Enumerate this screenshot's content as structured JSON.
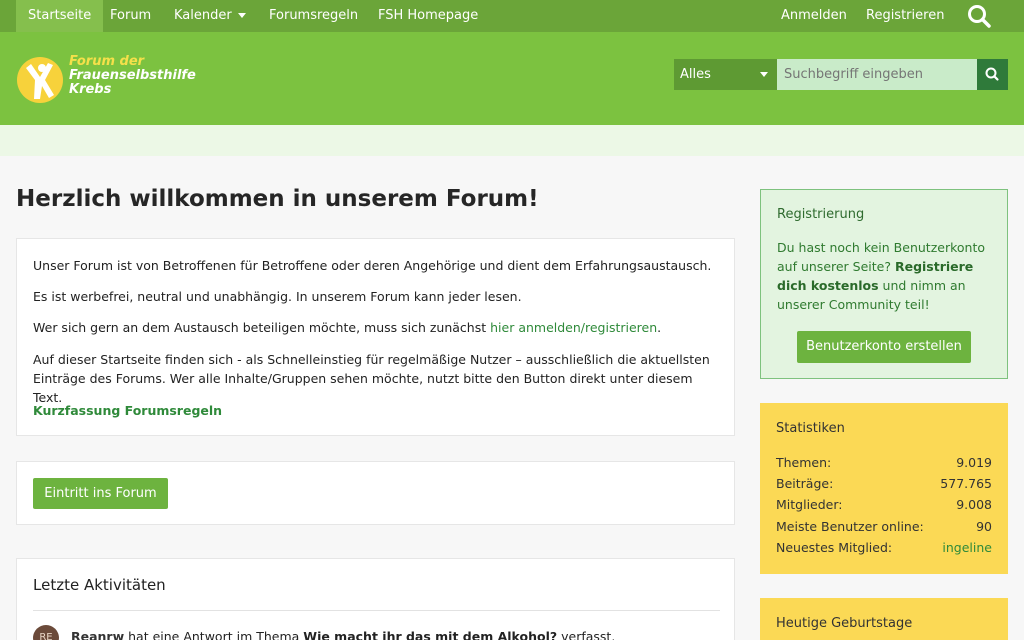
{
  "nav": {
    "items": [
      {
        "label": "Startseite"
      },
      {
        "label": "Forum"
      },
      {
        "label": "Kalender"
      },
      {
        "label": "Forumsregeln"
      },
      {
        "label": "FSH Homepage"
      }
    ],
    "right": [
      {
        "label": "Anmelden"
      },
      {
        "label": "Registrieren"
      }
    ]
  },
  "logo": {
    "line1": "Forum der",
    "line2": "Frauenselbsthilfe",
    "line3": "Krebs"
  },
  "search": {
    "scope": "Alles",
    "placeholder": "Suchbegriff eingeben"
  },
  "main": {
    "title": "Herzlich willkommen in unserem Forum!",
    "intro": {
      "p1": "Unser Forum ist von Betroffenen für Betroffene oder deren Angehörige und dient dem Erfahrungsaustausch.",
      "p2": "Es ist werbefrei, neutral und unabhängig. In unserem Forum kann jeder lesen.",
      "p3_text": "Wer sich gern an dem Austausch beteiligen möchte, muss sich zunächst ",
      "p3_link": "hier anmelden/registrieren",
      "p3_end": ".",
      "p4": "Auf dieser Startseite finden sich - als Schnelleinstieg für regelmäßige Nutzer – ausschließlich die aktuellsten Einträge des Forums. Wer alle Inhalte/Gruppen sehen möchte, nutzt bitte den Button direkt unter diesem Text.",
      "rules_link": "Kurzfassung Forumsregeln"
    },
    "enter_button": "Eintritt ins Forum",
    "activities": {
      "title": "Letzte Aktivitäten",
      "items": [
        {
          "avatar": "RE",
          "user": "Reanrw",
          "action": " hat eine Antwort im Thema ",
          "thread": "Wie macht ihr das mit dem Alkohol?",
          "end": " verfasst."
        }
      ]
    }
  },
  "sidebar": {
    "registration": {
      "title": "Registrierung",
      "text1": "Du hast noch kein Benutzerkonto auf unserer Seite? ",
      "bold": "Registriere dich kostenlos",
      "text2": " und nimm an unserer Community teil!",
      "button": "Benutzerkonto erstellen"
    },
    "stats": {
      "title": "Statistiken",
      "rows": [
        {
          "label": "Themen:",
          "value": "9.019"
        },
        {
          "label": "Beiträge:",
          "value": "577.765"
        },
        {
          "label": "Mitglieder:",
          "value": "9.008"
        },
        {
          "label": "Meiste Benutzer online:",
          "value": "90"
        },
        {
          "label": "Neuestes Mitglied:",
          "value": "ingeline"
        }
      ]
    },
    "birthdays": {
      "title": "Heutige Geburtstage"
    }
  },
  "colors": {
    "nav_bg": "#6ba539",
    "header_bg": "#7cc240",
    "accent_link": "#2f8a3a",
    "button_green": "#6db33f",
    "stats_bg": "#fbd955"
  }
}
